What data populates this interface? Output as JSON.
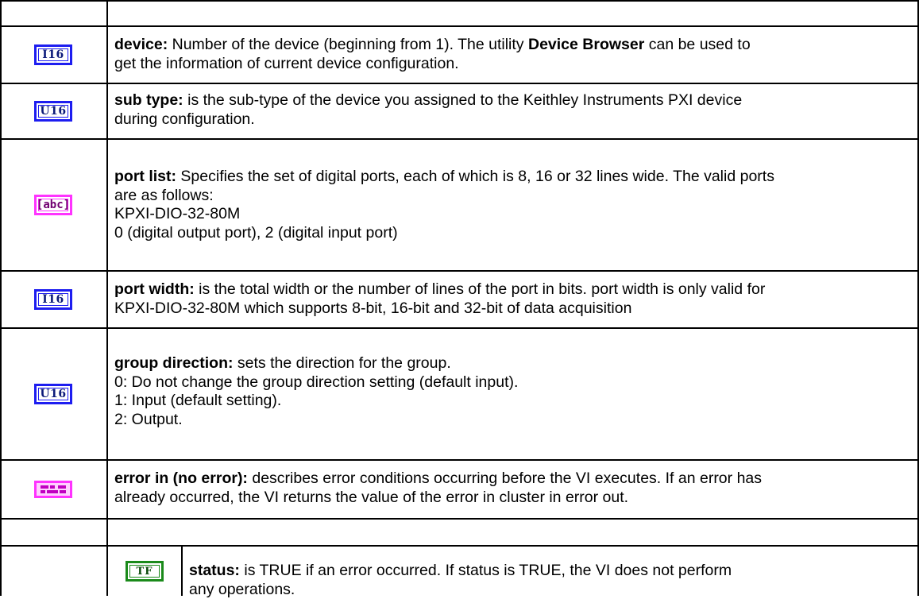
{
  "rows": [
    {
      "icon": {
        "name": "i16-terminal-icon",
        "label": "I16",
        "kind": "num"
      },
      "term": "device:",
      "lines": [
        {
          "before": " Number of the device (beginning from 1). The utility ",
          "bold": "Device Browser",
          "after": " can be used to"
        },
        {
          "text": "get the information of current device configuration."
        }
      ]
    },
    {
      "icon": {
        "name": "u16-terminal-icon",
        "label": "U16",
        "kind": "num"
      },
      "term": "sub type:",
      "lines": [
        {
          "text": " is the sub-type of the device you assigned to the Keithley Instruments PXI device"
        },
        {
          "text": "during configuration."
        }
      ]
    },
    {
      "icon": {
        "name": "string-terminal-icon",
        "label": "[abc]",
        "kind": "str"
      },
      "term": "port list:",
      "lines": [
        {
          "text": " Specifies the set of digital ports, each of which is 8, 16 or 32 lines wide. The valid ports"
        },
        {
          "text": "are as follows:"
        },
        {
          "text": "KPXI-DIO-32-80M"
        },
        {
          "text": "0 (digital output port), 2 (digital input port)"
        }
      ]
    },
    {
      "icon": {
        "name": "i16-terminal-icon",
        "label": "I16",
        "kind": "num"
      },
      "term": "port width:",
      "lines": [
        {
          "text": " is the total width or the number of lines of the port in bits. port width is only valid for"
        },
        {
          "text": "KPXI-DIO-32-80M which supports 8-bit, 16-bit and 32-bit of data acquisition"
        }
      ]
    },
    {
      "icon": {
        "name": "u16-terminal-icon",
        "label": "U16",
        "kind": "num"
      },
      "term": "group direction:",
      "lines": [
        {
          "text": " sets the direction for the group."
        },
        {
          "text": "0: Do not change the group direction setting (default input)."
        },
        {
          "text": "1: Input (default setting)."
        },
        {
          "text": "2: Output."
        }
      ]
    },
    {
      "icon": {
        "name": "error-cluster-icon",
        "label": "",
        "kind": "clu"
      },
      "term": "error in (no error):",
      "lines": [
        {
          "text": " describes error conditions occurring before the VI executes. If an error has"
        },
        {
          "text": "already occurred, the VI returns the value of the error in cluster in error out."
        }
      ]
    }
  ],
  "subrow": {
    "icon": {
      "name": "boolean-terminal-icon",
      "label": "TF",
      "kind": "bool"
    },
    "term": "status:",
    "lines": [
      {
        "text": " is TRUE if an error occurred.  If status is TRUE, the VI does not perform"
      },
      {
        "text": "any operations."
      }
    ]
  }
}
